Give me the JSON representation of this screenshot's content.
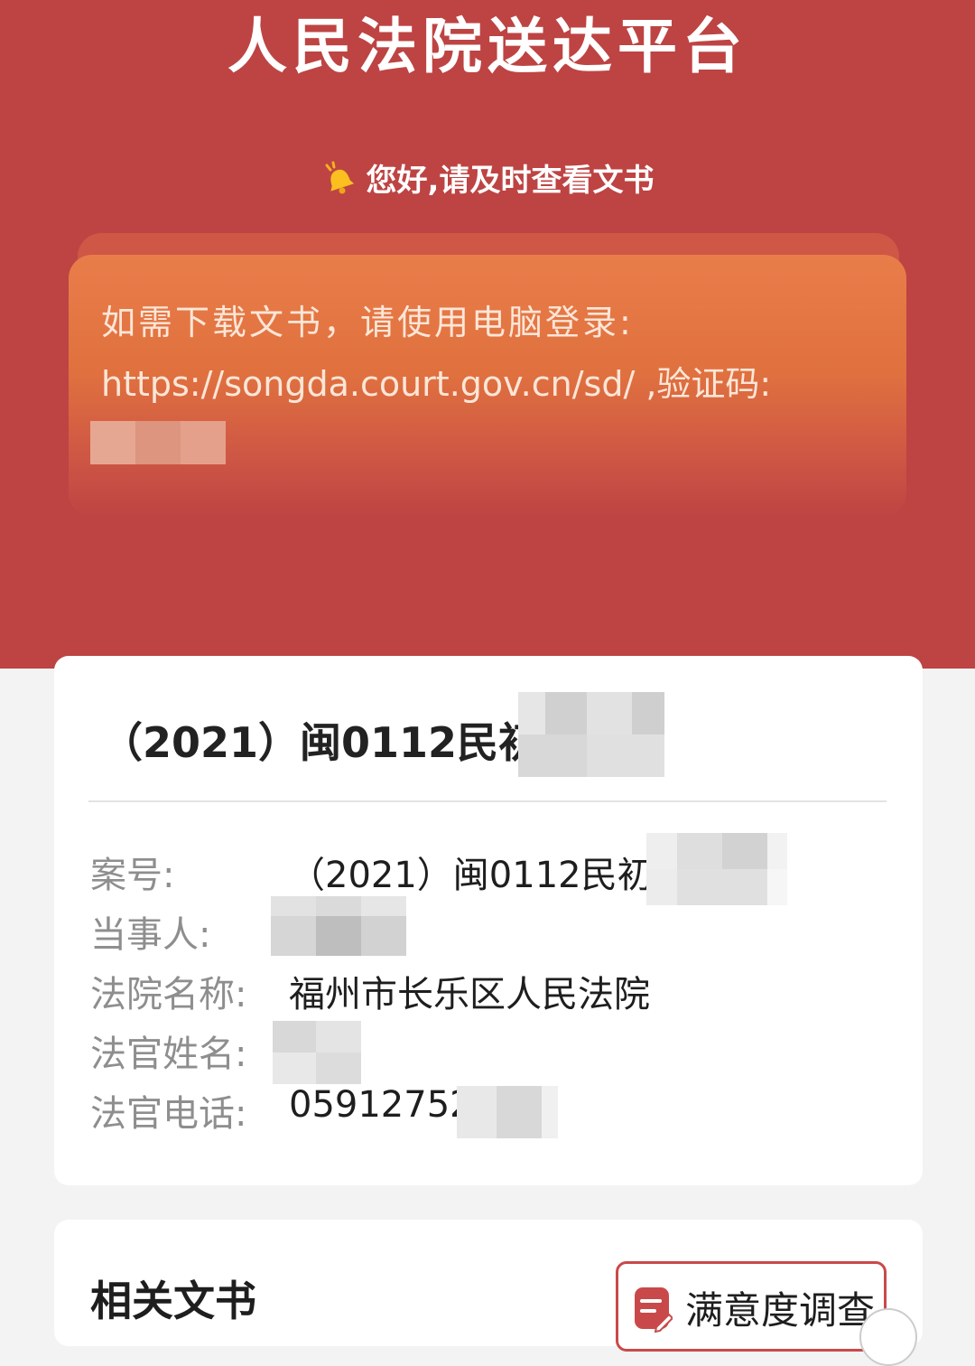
{
  "header": {
    "title": "人民法院送达平台",
    "greeting": "您好,请及时查看文书"
  },
  "notice": {
    "line1": "如需下载文书，请使用电脑登录:",
    "line2": "https://songda.court.gov.cn/sd/ ,验证码:"
  },
  "case_card": {
    "title": "（2021）闽0112民初",
    "fields": [
      {
        "label": "案号:",
        "value": "（2021）闽0112民初"
      },
      {
        "label": "当事人:",
        "value": ""
      },
      {
        "label": "法院名称:",
        "value": "福州市长乐区人民法院"
      },
      {
        "label": "法官姓名:",
        "value": ""
      },
      {
        "label": "法官电话:",
        "value": "05912752"
      }
    ]
  },
  "documents": {
    "title": "相关文书",
    "survey_button": "满意度调查"
  },
  "icons": {
    "bell": "bell-icon",
    "survey": "survey-icon"
  },
  "colors": {
    "brand_red": "#bd4443",
    "notice_orange": "#e97d4a",
    "button_border": "#c9494a"
  }
}
